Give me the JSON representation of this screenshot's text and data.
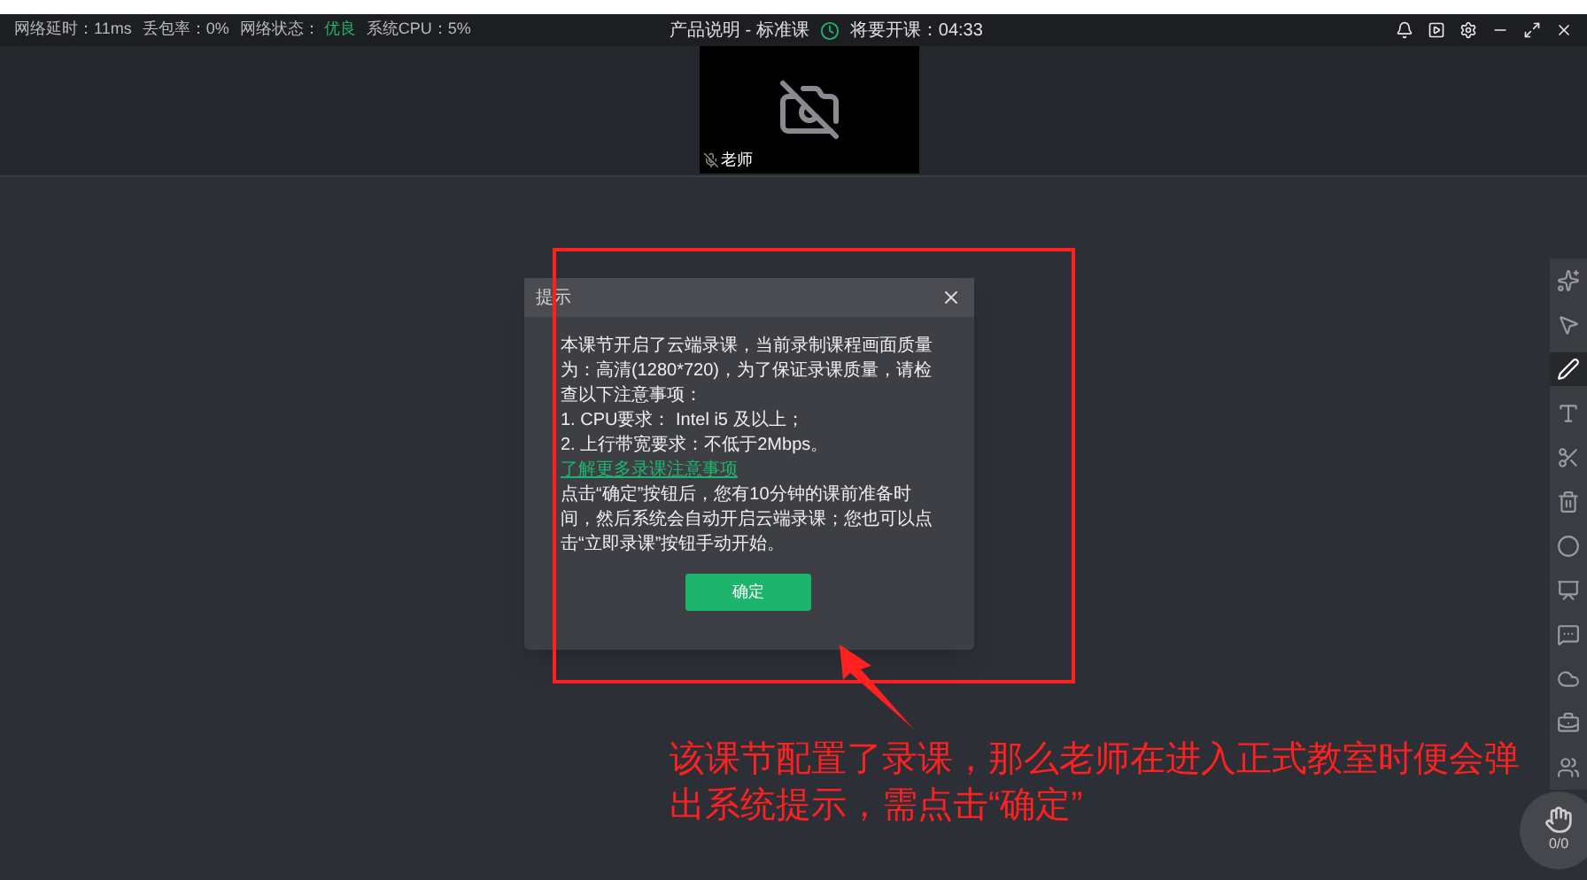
{
  "title_bar": {
    "stats": [
      {
        "label": "网络延时：11ms"
      },
      {
        "label": "丢包率：0%"
      },
      {
        "label": "网络状态：",
        "value": "优良"
      },
      {
        "label": "系统CPU：5%"
      }
    ],
    "title": "产品说明 - 标准课",
    "countdown": "将要开课：04:33"
  },
  "video": {
    "name": "老师"
  },
  "dialog": {
    "title": "提示",
    "paragraphs": [
      "本课节开启了云端录课，当前录制课程画面质量为：高清(1280*720)，为了保证录课质量，请检查以下注意事项：",
      "1. CPU要求： Intel i5 及以上；",
      "2. 上行带宽要求：不低于2Mbps。"
    ],
    "link": "了解更多录课注意事项",
    "note": "点击“确定”按钮后，您有10分钟的课前准备时间，然后系统会自动开启云端录课；您也可以点击“立即录课”按钮手动开始。",
    "confirm": "确定"
  },
  "annotation": "该课节配置了录课，那么老师在进入正式教室时便会弹出系统提示，需点击“确定”",
  "tools": [
    {
      "kind": "laser",
      "selected": false
    },
    {
      "kind": "pointer",
      "selected": false
    },
    {
      "kind": "pen",
      "selected": true
    },
    {
      "kind": "text",
      "selected": false
    },
    {
      "kind": "scissors",
      "selected": false
    },
    {
      "kind": "trash",
      "selected": false
    },
    {
      "kind": "shape",
      "selected": false
    },
    {
      "kind": "slides",
      "selected": false
    },
    {
      "kind": "chat",
      "selected": false
    },
    {
      "kind": "cloud",
      "selected": false
    },
    {
      "kind": "toolbox",
      "selected": false
    },
    {
      "kind": "users",
      "selected": false
    }
  ],
  "hand_raise": {
    "count": "0/0"
  }
}
